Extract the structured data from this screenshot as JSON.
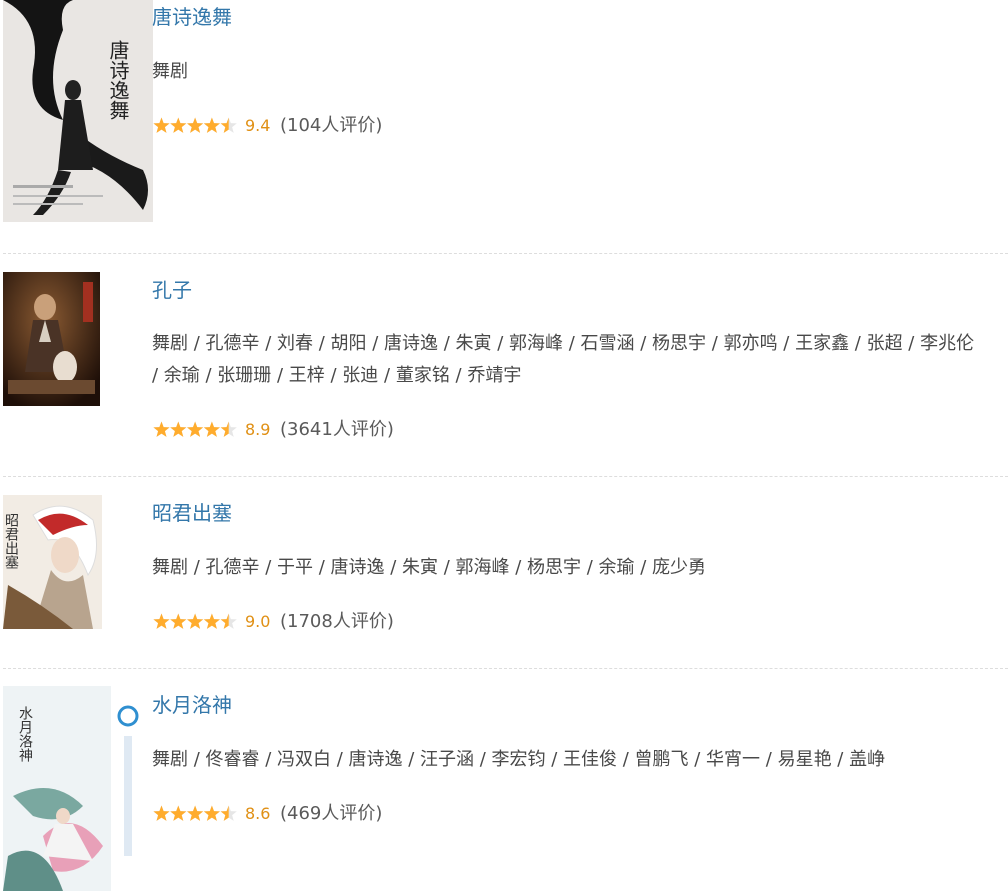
{
  "items": [
    {
      "title": "唐诗逸舞",
      "meta_line1": "舞剧",
      "meta_line2": "",
      "rating": 9.4,
      "score": "9.4",
      "count": "(104人评价)",
      "poster_icon": "poster-dancer-black-sleeves"
    },
    {
      "title": "孔子",
      "meta_line1": "舞剧 / 孔德辛 / 刘春 / 胡阳 / 唐诗逸 / 朱寅 / 郭海峰 / 石雪涵 / 杨思宇 / 郭亦鸣 / 王家鑫 / 张超 / 李兆伦",
      "meta_line2": "/ 余瑜 / 张珊珊 / 王梓 / 张迪 / 董家铭 / 乔靖宇",
      "rating": 8.9,
      "score": "8.9",
      "count": "(3641人评价)",
      "poster_icon": "poster-confucius"
    },
    {
      "title": "昭君出塞",
      "meta_line1": "舞剧 / 孔德辛 / 于平 / 唐诗逸 / 朱寅 / 郭海峰 / 杨思宇 / 余瑜 / 庞少勇",
      "meta_line2": "",
      "rating": 9.0,
      "score": "9.0",
      "count": "(1708人评价)",
      "poster_icon": "poster-zhaojun"
    },
    {
      "title": "水月洛神",
      "meta_line1": "舞剧 / 佟睿睿 / 冯双白 / 唐诗逸 / 汪子涵 / 李宏钧 / 王佳俊 / 曾鹏飞 / 华宵一 / 易星艳 / 盖峥",
      "meta_line2": "",
      "rating": 8.6,
      "score": "8.6",
      "count": "(469人评价)",
      "poster_icon": "poster-luoshen"
    }
  ],
  "poster_text": {
    "p1": "唐诗逸舞",
    "p3": "昭君出塞",
    "p4": "水月洛神"
  },
  "colors": {
    "title": "#3377aa",
    "star": "#ffac2d",
    "score": "#e09015"
  }
}
